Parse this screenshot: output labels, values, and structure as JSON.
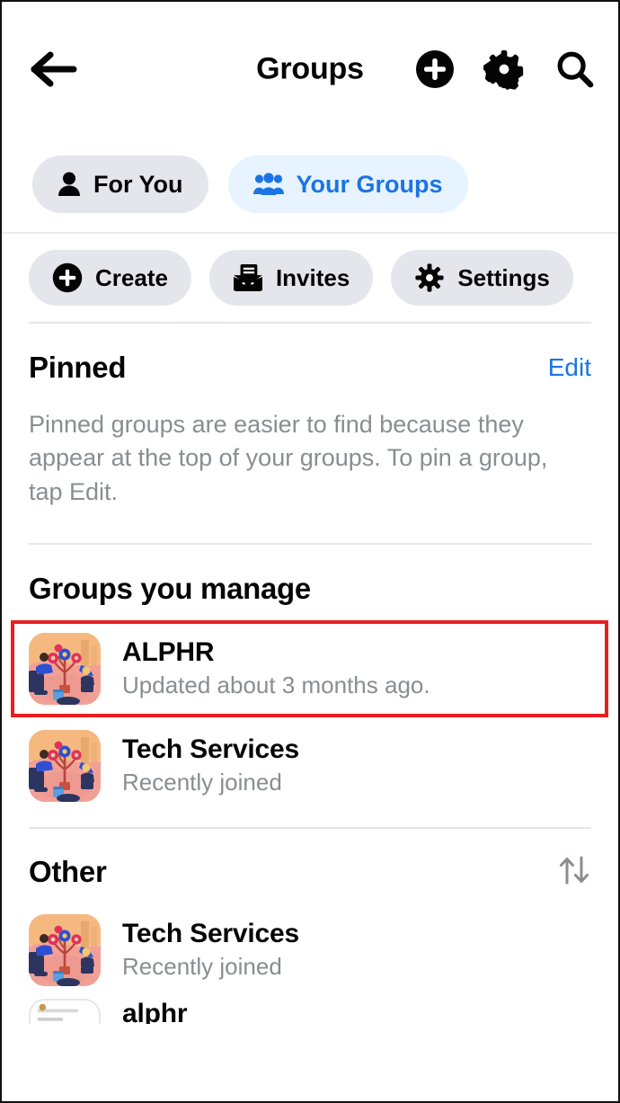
{
  "header": {
    "title": "Groups",
    "back_icon": "arrow-left-icon",
    "add_icon": "plus-circle-icon",
    "settings_icon": "gear-icon",
    "search_icon": "search-icon"
  },
  "tabs": [
    {
      "label": "For You",
      "icon": "person-icon",
      "selected": false
    },
    {
      "label": "Your Groups",
      "icon": "people-group-icon",
      "selected": true
    }
  ],
  "actions": [
    {
      "label": "Create",
      "icon": "plus-circle-icon"
    },
    {
      "label": "Invites",
      "icon": "envelope-invite-icon"
    },
    {
      "label": "Settings",
      "icon": "gear-icon"
    }
  ],
  "pinned": {
    "title": "Pinned",
    "edit_label": "Edit",
    "description": "Pinned groups are easier to find because they appear at the top of your groups. To pin a group, tap Edit."
  },
  "managed": {
    "title": "Groups you manage",
    "groups": [
      {
        "name": "ALPHR",
        "subtitle": "Updated about 3 months ago.",
        "highlighted": true
      },
      {
        "name": "Tech Services",
        "subtitle": "Recently joined",
        "highlighted": false
      }
    ]
  },
  "other": {
    "title": "Other",
    "sort_icon": "sort-arrows-icon",
    "groups": [
      {
        "name": "Tech Services",
        "subtitle": "Recently joined"
      },
      {
        "name": "alphr",
        "subtitle": ""
      }
    ]
  },
  "colors": {
    "accent_blue": "#1b74e4",
    "tab_active_bg": "#e7f3ff",
    "chip_bg": "#e4e6eb",
    "muted_text": "#8a8d91",
    "highlight_red": "#e81f20",
    "primary_text": "#050505"
  }
}
